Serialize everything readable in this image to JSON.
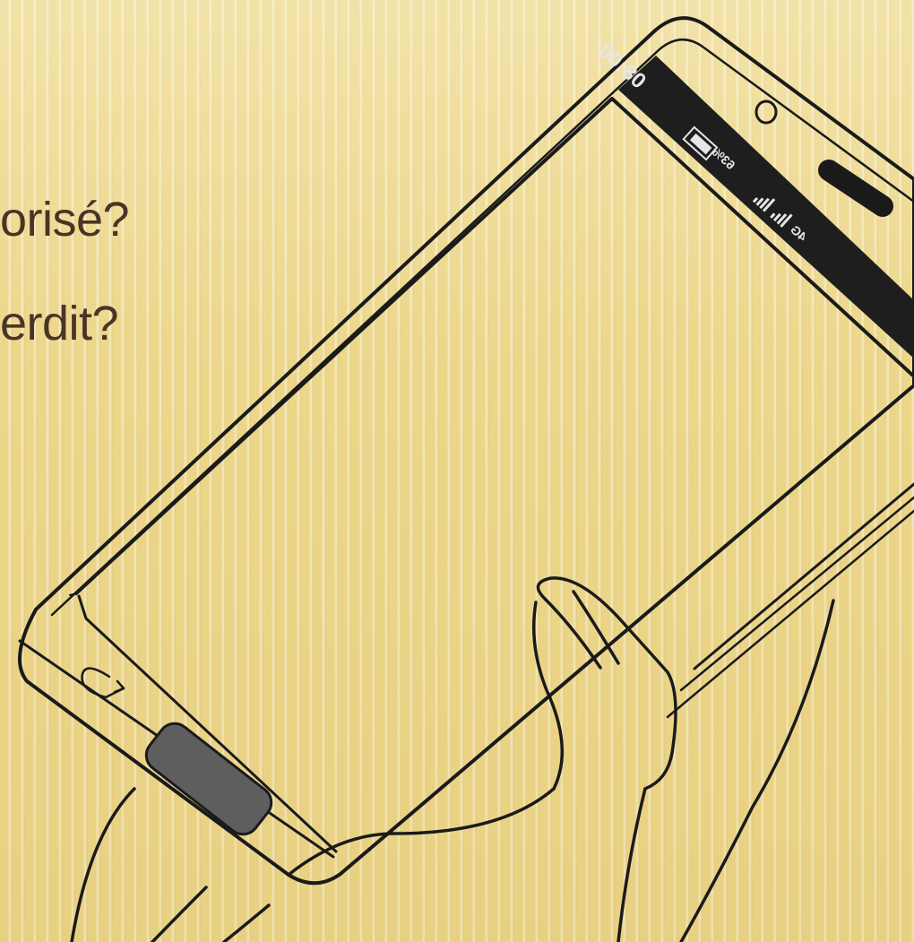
{
  "slide": {
    "lines": [
      "orisé?",
      "erdit?"
    ]
  },
  "phone": {
    "status_bar": {
      "time": "08:00",
      "battery": "63%",
      "network": "4G"
    }
  },
  "colors": {
    "background": "#ecd68a",
    "text": "#4a3425",
    "outline": "#1a1a1a",
    "button": "#5e5e5e"
  }
}
